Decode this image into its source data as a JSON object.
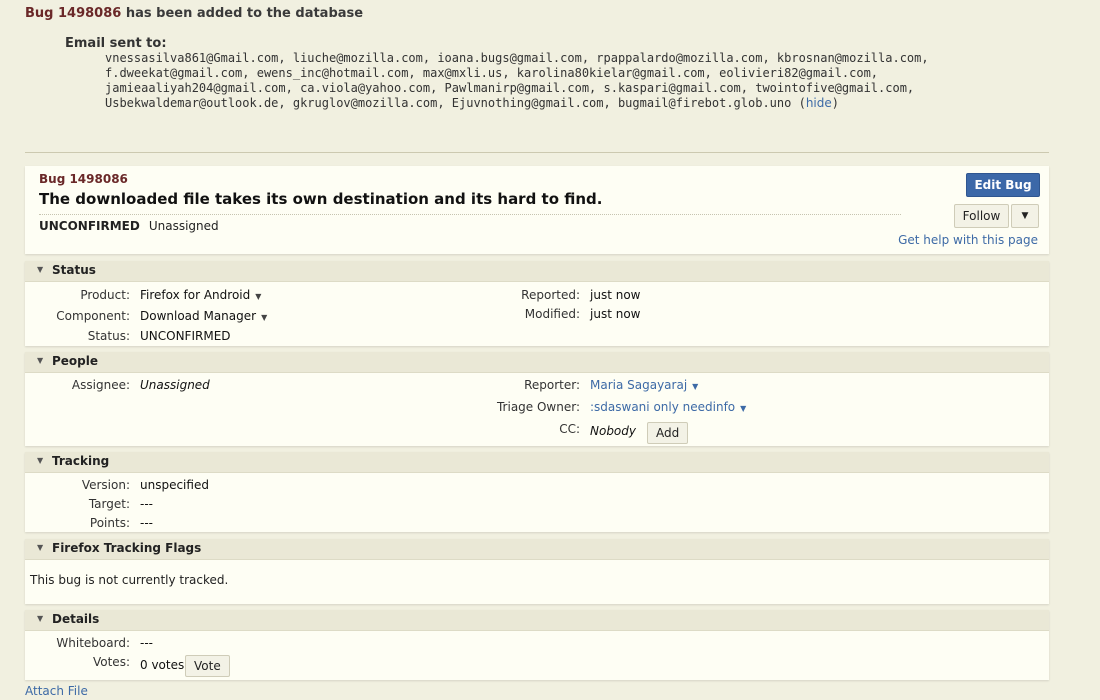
{
  "message": {
    "bug_number": "Bug 1498086",
    "text": "has been added to the database",
    "email_label": "Email sent to:",
    "emails": "vnessasilva861@Gmail.com, liuche@mozilla.com, ioana.bugs@gmail.com, rpappalardo@mozilla.com, kbrosnan@mozilla.com, f.dweekat@gmail.com, ewens_inc@hotmail.com, max@mxli.us, karolina80kielar@gmail.com, eolivieri82@gmail.com, jamieaaliyah204@gmail.com, ca.viola@yahoo.com, Pawlmanirp@gmail.com, s.kaspari@gmail.com, twointofive@gmail.com, Usbekwaldemar@outlook.de, gkruglov@mozilla.com, Ejuvnothing@gmail.com, bugmail@firebot.glob.uno",
    "paren_open": "(",
    "hide_label": "hide",
    "paren_close": ")"
  },
  "header": {
    "bug_number": "Bug 1498086",
    "summary": "The downloaded file takes its own destination and its hard to find.",
    "status": "UNCONFIRMED",
    "assignee": "Unassigned",
    "edit_label": "Edit Bug",
    "follow_label": "Follow",
    "follow_dropdown": "▼",
    "help_label": "Get help with this page"
  },
  "status_section": {
    "title": "Status",
    "product_label": "Product:",
    "product_value": "Firefox for Android",
    "component_label": "Component:",
    "component_value": "Download Manager",
    "status_label": "Status:",
    "status_value": "UNCONFIRMED",
    "reported_label": "Reported:",
    "reported_value": "just now",
    "modified_label": "Modified:",
    "modified_value": "just now"
  },
  "people_section": {
    "title": "People",
    "assignee_label": "Assignee:",
    "assignee_value": "Unassigned",
    "reporter_label": "Reporter:",
    "reporter_value": "Maria Sagayaraj",
    "triage_label": "Triage Owner:",
    "triage_value": ":sdaswani only needinfo",
    "cc_label": "CC:",
    "cc_value": "Nobody",
    "add_label": "Add"
  },
  "tracking_section": {
    "title": "Tracking",
    "version_label": "Version:",
    "version_value": "unspecified",
    "target_label": "Target:",
    "target_value": "---",
    "points_label": "Points:",
    "points_value": "---"
  },
  "fxflags_section": {
    "title": "Firefox Tracking Flags",
    "text": "This bug is not currently tracked."
  },
  "details_section": {
    "title": "Details",
    "whiteboard_label": "Whiteboard:",
    "whiteboard_value": "---",
    "votes_label": "Votes:",
    "votes_value": "0 votes",
    "vote_label": "Vote"
  },
  "footer": {
    "attach_label": "Attach File"
  },
  "icons": {
    "triangle": "▼",
    "dropdown": "▼"
  },
  "colors": {
    "background": "#f1f0e0",
    "card": "#fefef4",
    "section_header": "#eae8d6",
    "link": "#3d6aa6",
    "primary_button": "#3c68a8",
    "bug_number": "#6a2828"
  }
}
